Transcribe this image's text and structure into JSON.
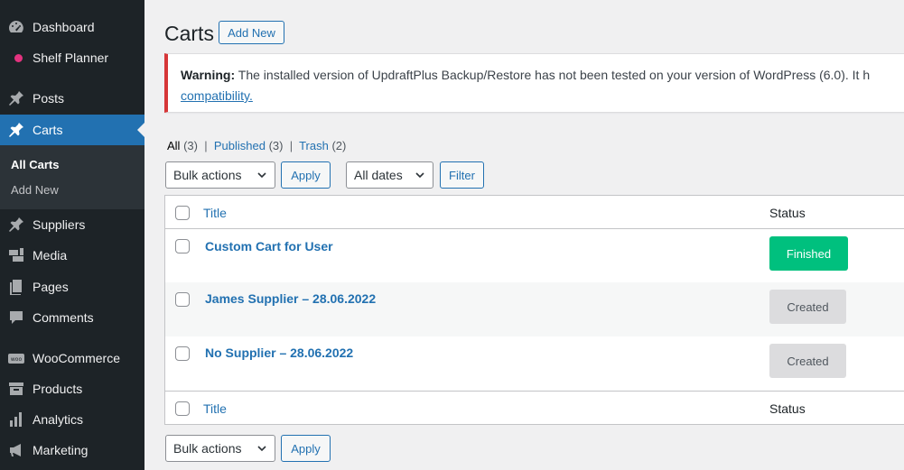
{
  "sidebar": {
    "items": [
      {
        "label": "Dashboard",
        "icon": "dashboard-icon"
      },
      {
        "label": "Shelf Planner",
        "icon": "dot-icon"
      },
      {
        "label": "Posts",
        "icon": "pin-icon"
      },
      {
        "label": "Carts",
        "icon": "pin-icon"
      },
      {
        "label": "Suppliers",
        "icon": "pin-icon"
      },
      {
        "label": "Media",
        "icon": "media-icon"
      },
      {
        "label": "Pages",
        "icon": "pages-icon"
      },
      {
        "label": "Comments",
        "icon": "comments-icon"
      },
      {
        "label": "WooCommerce",
        "icon": "woo-icon"
      },
      {
        "label": "Products",
        "icon": "archive-icon"
      },
      {
        "label": "Analytics",
        "icon": "bar-chart-icon"
      },
      {
        "label": "Marketing",
        "icon": "megaphone-icon"
      }
    ],
    "submenu": [
      "All Carts",
      "Add New"
    ]
  },
  "header": {
    "title": "Carts",
    "add_new": "Add New"
  },
  "notice": {
    "label": "Warning:",
    "text": " The installed version of UpdraftPlus Backup/Restore has not been tested on your version of WordPress (6.0). It h",
    "link": "compatibility."
  },
  "views": {
    "all": "All",
    "all_count": "(3)",
    "published": "Published",
    "published_count": "(3)",
    "trash": "Trash",
    "trash_count": "(2)",
    "sep": "|"
  },
  "toolbar": {
    "bulk_actions": "Bulk actions",
    "apply": "Apply",
    "all_dates": "All dates",
    "filter": "Filter"
  },
  "table": {
    "columns": {
      "title": "Title",
      "status": "Status"
    },
    "rows": [
      {
        "title": "Custom Cart for User",
        "status": "Finished"
      },
      {
        "title": "James Supplier – 28.06.2022",
        "status": "Created"
      },
      {
        "title": "No Supplier – 28.06.2022",
        "status": "Created"
      }
    ]
  },
  "colors": {
    "accent": "#2271b1",
    "sidebar": "#1d2327",
    "finished": "#00c07e",
    "warning": "#d63638"
  }
}
